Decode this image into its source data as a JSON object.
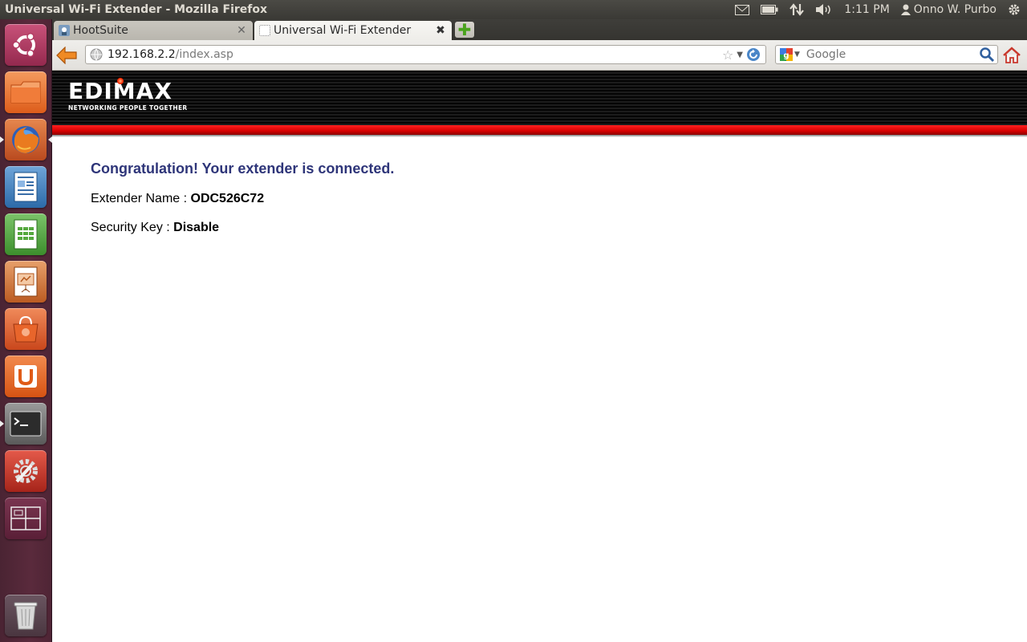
{
  "top_panel": {
    "window_title": "Universal Wi-Fi Extender - Mozilla Firefox",
    "clock": "1:11 PM",
    "user_name": "Onno W. Purbo",
    "icons": [
      "mail-icon",
      "battery-icon",
      "network-icon",
      "volume-icon",
      "user-icon",
      "gear-icon"
    ]
  },
  "launcher": {
    "items": [
      "ubuntu-logo",
      "files",
      "firefox",
      "writer",
      "calc",
      "impress",
      "software-center",
      "ubuntu-one",
      "terminal",
      "system-settings",
      "workspace-switcher",
      "trash"
    ]
  },
  "browser": {
    "tabs": [
      {
        "label": "HootSuite",
        "active": false
      },
      {
        "label": "Universal Wi-Fi Extender",
        "active": true
      }
    ],
    "url_host": "192.168.2.2",
    "url_path": "/index.asp",
    "search_placeholder": "Google"
  },
  "page": {
    "brand": {
      "name": "EDIMAX",
      "tagline": "NETWORKING PEOPLE TOGETHER",
      "accent_color": "#e00000"
    },
    "heading": "Congratulation! Your extender is connected.",
    "extender_name_label": "Extender Name : ",
    "extender_name_value": "ODC526C72",
    "security_key_label": "Security Key : ",
    "security_key_value": "Disable"
  }
}
